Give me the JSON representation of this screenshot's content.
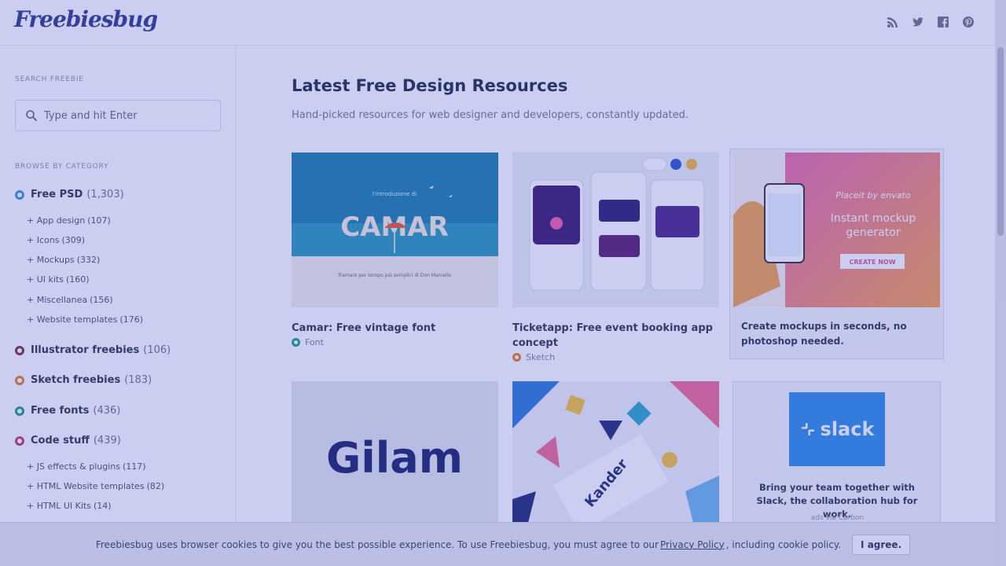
{
  "brand": {
    "logo_text": "Freebiesbug"
  },
  "header": {
    "social": [
      "rss-icon",
      "twitter-icon",
      "facebook-icon",
      "pinterest-icon"
    ]
  },
  "sidebar": {
    "search_label": "SEARCH FREEBIE",
    "search_placeholder": "Type and hit Enter",
    "browse_label": "BROWSE BY CATEGORY",
    "categories": [
      {
        "label": "Free PSD",
        "count": "(1,303)",
        "color": "#3498db"
      },
      {
        "label": "Illustrator freebies",
        "count": "(106)",
        "color": "#7b2d3b"
      },
      {
        "label": "Sketch freebies",
        "count": "(183)",
        "color": "#e67e22"
      },
      {
        "label": "Free fonts",
        "count": "(436)",
        "color": "#16a085"
      },
      {
        "label": "Code stuff",
        "count": "(439)",
        "color": "#c0396b"
      }
    ],
    "psd_subs": [
      {
        "label": "+ App design",
        "count": "(107)"
      },
      {
        "label": "+ Icons",
        "count": "(309)"
      },
      {
        "label": "+ Mockups",
        "count": "(332)"
      },
      {
        "label": "+ UI kits",
        "count": "(160)"
      },
      {
        "label": "+ Miscellanea",
        "count": "(156)"
      },
      {
        "label": "+ Website templates",
        "count": "(176)"
      }
    ],
    "code_subs": [
      {
        "label": "+ JS effects & plugins",
        "count": "(117)"
      },
      {
        "label": "+ HTML Website templates",
        "count": "(82)"
      },
      {
        "label": "+ HTML UI Kits",
        "count": "(14)"
      }
    ]
  },
  "main": {
    "title": "Latest Free Design Resources",
    "subtitle": "Hand-picked resources for web designer and developers, constantly updated.",
    "cards": [
      {
        "title": "Camar: Free vintage font",
        "category": "Font",
        "thumb_text": "CAMAR",
        "thumb_small": "l'introduzione di",
        "thumb_caption": "Tramare per tempo più semplici di Don Marcello"
      },
      {
        "title": "Ticketapp: Free event booking app concept",
        "category": "Sketch"
      },
      {
        "title": "Gilam",
        "thumb_text": "Gilam"
      },
      {
        "title": "Kander",
        "thumb_text": "Kander"
      }
    ],
    "ad_placeit": {
      "brand": "Placeit by envato",
      "headline": "Instant mockup generator",
      "cta": "CREATE NOW",
      "text": "Create mockups in seconds, no photoshop needed."
    },
    "ad_carbon": {
      "logo": "slack",
      "text": "Bring your team together with Slack, the collaboration hub for work.",
      "via": "ads via Carbon"
    }
  },
  "cookie": {
    "text_before": "Freebiesbug uses browser cookies to give you the best possible experience. To use Freebiesbug, you must agree to our",
    "link": "Privacy Policy",
    "text_after": ", including cookie policy.",
    "button": "I agree."
  }
}
